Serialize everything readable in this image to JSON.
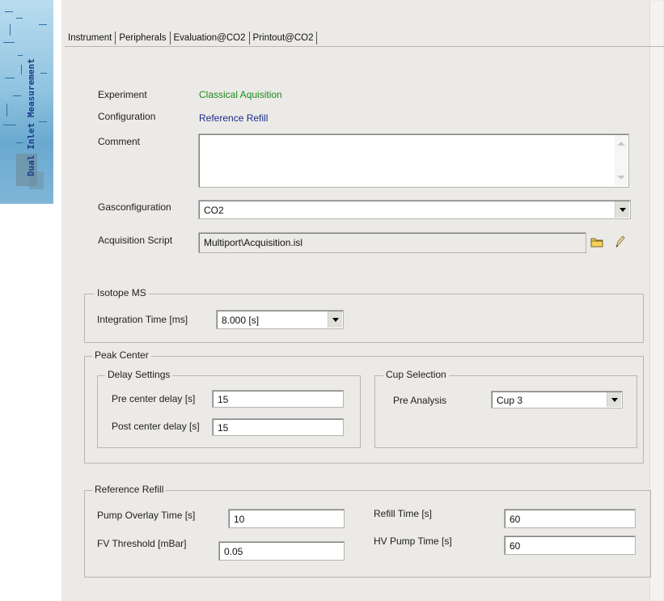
{
  "banner": {
    "text": "Dual Inlet Measurement"
  },
  "tabs": [
    "Instrument",
    "Peripherals",
    "Evaluation@CO2",
    "Printout@CO2"
  ],
  "instrument": {
    "experiment_label": "Experiment",
    "experiment_value": "Classical Aquisition",
    "configuration_label": "Configuration",
    "configuration_value": "Reference Refill",
    "comment_label": "Comment",
    "comment_value": "",
    "gasconfiguration_label": "Gasconfiguration",
    "gasconfiguration_value": "CO2",
    "acquisition_script_label": "Acquisition Script",
    "acquisition_script_value": "Multiport\\Acquisition.isl",
    "folder_icon": "folder-icon",
    "edit_icon": "pencil-icon"
  },
  "isotope_ms": {
    "title": "Isotope MS",
    "integration_time_label": "Integration Time [ms]",
    "integration_time_value": "8.000 [s]"
  },
  "peak_center": {
    "title": "Peak Center",
    "delay_settings": {
      "title": "Delay Settings",
      "pre_label": "Pre center delay [s]",
      "pre_value": "15",
      "post_label": "Post center delay [s]",
      "post_value": "15"
    },
    "cup_selection": {
      "title": "Cup Selection",
      "pre_analysis_label": "Pre Analysis",
      "pre_analysis_value": "Cup 3"
    }
  },
  "reference_refill": {
    "title": "Reference Refill",
    "pump_overlay_label": "Pump Overlay Time [s]",
    "pump_overlay_value": "10",
    "fv_threshold_label": "FV Threshold [mBar]",
    "fv_threshold_value": "0.05",
    "refill_time_label": "Refill Time [s]",
    "refill_time_value": "60",
    "hv_pump_label": "HV Pump Time [s]",
    "hv_pump_value": "60"
  },
  "colors": {
    "panel": "#eceae6",
    "experiment_value": "#1c8a1c",
    "configuration_value": "#1a2c8c",
    "banner": "#8fc3e0"
  }
}
